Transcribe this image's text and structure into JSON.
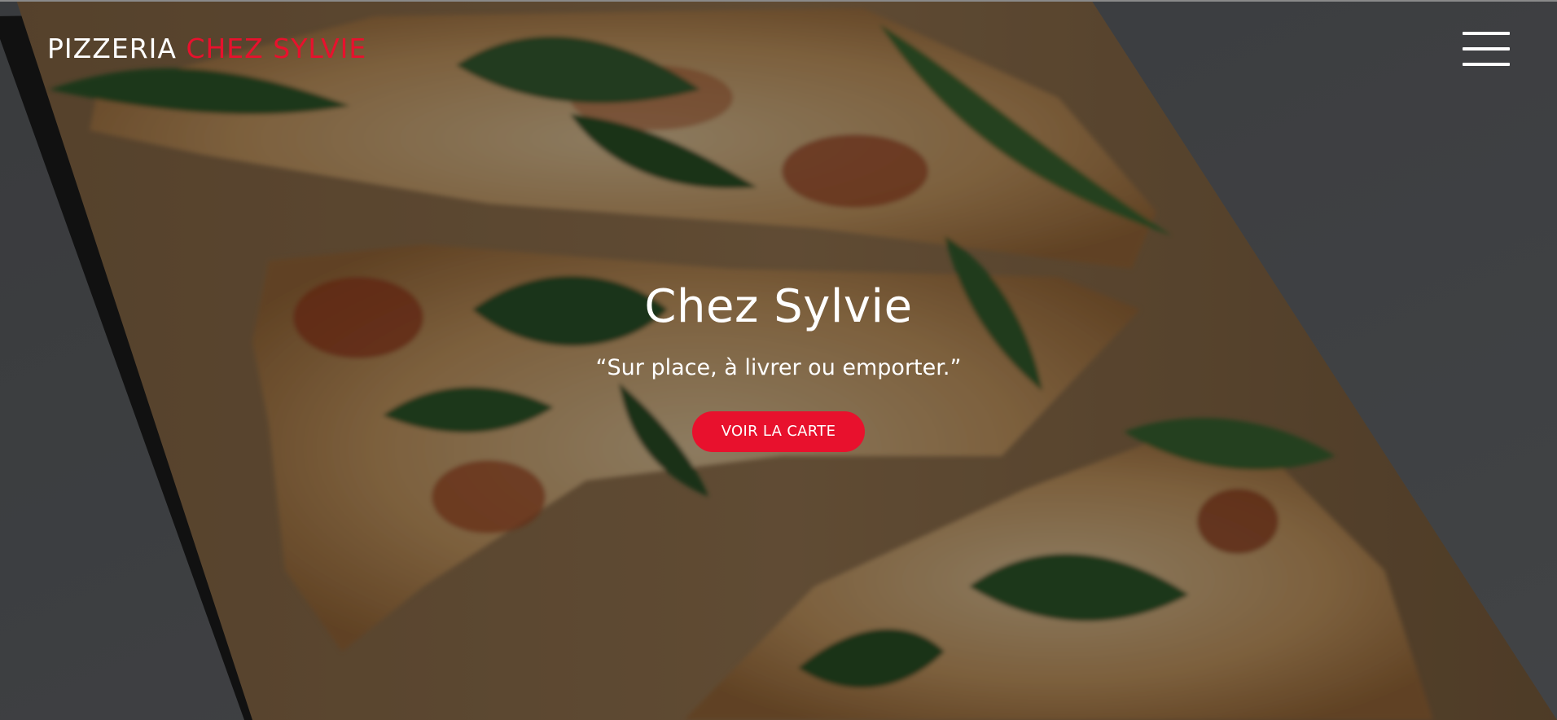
{
  "header": {
    "brand_part1": "PIZZERIA",
    "brand_part2": "CHEZ SYLVIE",
    "menu_icon": "hamburger-menu-icon"
  },
  "hero": {
    "title": "Chez Sylvie",
    "tagline": "“Sur place, à livrer ou emporter.”",
    "cta_label": "VOIR LA CARTE"
  },
  "colors": {
    "accent": "#e8112d",
    "text": "#ffffff",
    "background": "#55585c",
    "board": "#6b4f33"
  }
}
